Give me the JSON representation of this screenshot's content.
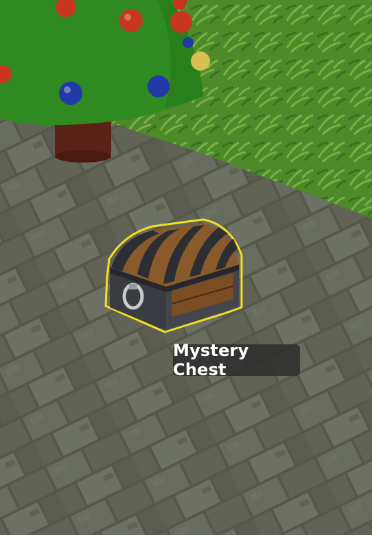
{
  "scene": {
    "type": "3d-game-view",
    "colors": {
      "grass": "#4e8a2a",
      "stone": "#6a6b5d",
      "tree_foliage": "#2f8a22",
      "tree_trunk": "#5a2216",
      "chest_wood": "#8a5a2a",
      "chest_metal": "#2c2e33",
      "highlight": "#f2e020"
    },
    "objects": {
      "tree": {
        "icon": "christmas-tree",
        "ornament_colors": [
          "#c7371f",
          "#2439a8",
          "#d8c050"
        ]
      },
      "chest": {
        "icon": "treasure-chest",
        "highlighted": true
      }
    }
  },
  "tooltip": {
    "label": "Mystery Chest"
  }
}
